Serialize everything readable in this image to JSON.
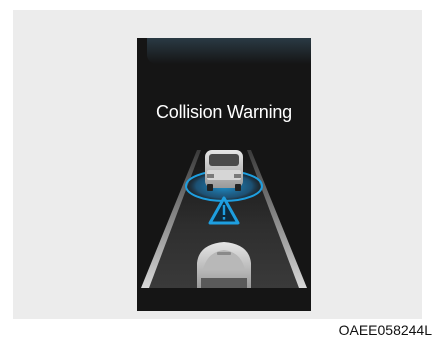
{
  "display": {
    "message": "Collision Warning"
  },
  "figure": {
    "code": "OAEE058244L"
  },
  "colors": {
    "background_panel": "#ececec",
    "display_background": "#151515",
    "warning_accent": "#1e9fe0",
    "text": "#ffffff"
  },
  "icons": {
    "warning": "warning-triangle-icon",
    "vehicle_ahead": "car-front-icon",
    "own_vehicle": "car-own-icon"
  }
}
